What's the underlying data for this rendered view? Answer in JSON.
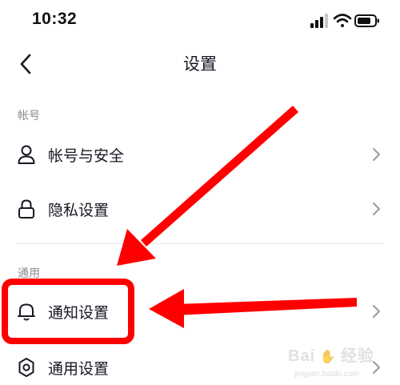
{
  "status_bar": {
    "time": "10:32",
    "icons": [
      "signal-icon",
      "wifi-icon",
      "battery-icon"
    ]
  },
  "nav": {
    "title": "设置",
    "back_icon": "chevron-left-icon"
  },
  "sections": [
    {
      "header": "帐号",
      "items": [
        {
          "label": "帐号与安全",
          "icon": "user-icon"
        },
        {
          "label": "隐私设置",
          "icon": "lock-icon"
        }
      ]
    },
    {
      "header": "通用",
      "items": [
        {
          "label": "通知设置",
          "icon": "bell-icon",
          "highlighted": true
        },
        {
          "label": "通用设置",
          "icon": "gear-icon"
        }
      ]
    }
  ],
  "annotation": {
    "color": "#ff0000",
    "highlight_target": "通知设置"
  },
  "watermark": {
    "text": "Bai",
    "text2": "经验",
    "sub": "jingyan.baidu.com"
  }
}
